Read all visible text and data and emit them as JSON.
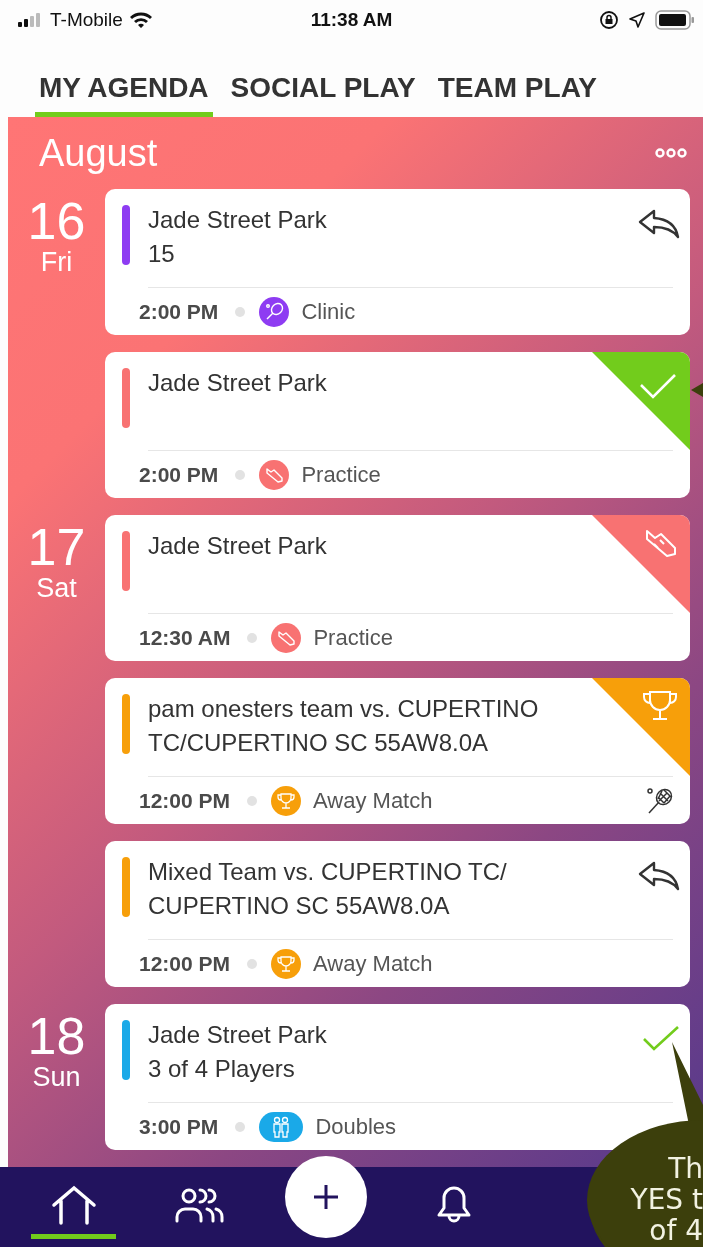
{
  "status_bar": {
    "carrier": "T-Mobile",
    "time": "11:38 AM"
  },
  "tabs": [
    {
      "label": "MY AGENDA",
      "selected": true
    },
    {
      "label": "SOCIAL PLAY",
      "selected": false
    },
    {
      "label": "TEAM PLAY",
      "selected": false
    }
  ],
  "month": "August",
  "days": [
    {
      "day": "16",
      "weekday": "Fri",
      "events": [
        {
          "color": "#8e3cf2",
          "lines": [
            "Jade Street Park",
            "15"
          ],
          "time": "2:00 PM",
          "category": {
            "kind": "clinic",
            "label": "Clinic"
          },
          "corner": {
            "kind": "reply"
          },
          "racquet": false
        },
        {
          "color": "#f87272",
          "lines": [
            "Jade Street Park"
          ],
          "time": "2:00 PM",
          "category": {
            "kind": "practice",
            "label": "Practice"
          },
          "corner": {
            "kind": "checkbanner"
          },
          "racquet": false
        }
      ]
    },
    {
      "day": "17",
      "weekday": "Sat",
      "events": [
        {
          "color": "#f87272",
          "lines": [
            "Jade Street Park"
          ],
          "time": "12:30 AM",
          "category": {
            "kind": "practice",
            "label": "Practice"
          },
          "corner": {
            "kind": "shoebanner"
          },
          "racquet": false
        },
        {
          "color": "#f79f0a",
          "lines": [
            "pam onesters team vs. CUPERTINO",
            "TC/CUPERTINO SC 55AW8.0A"
          ],
          "time": "12:00 PM",
          "category": {
            "kind": "match",
            "label": "Away Match"
          },
          "corner": {
            "kind": "trophybanner"
          },
          "racquet": true
        },
        {
          "color": "#f79f0a",
          "lines": [
            "Mixed Team vs. CUPERTINO TC/",
            "CUPERTINO SC 55AW8.0A"
          ],
          "time": "12:00 PM",
          "category": {
            "kind": "match",
            "label": "Away Match"
          },
          "corner": {
            "kind": "reply"
          },
          "racquet": false
        }
      ]
    },
    {
      "day": "18",
      "weekday": "Sun",
      "events": [
        {
          "color": "#1aa9e8",
          "lines": [
            "Jade Street Park",
            "3 of 4 Players"
          ],
          "time": "3:00 PM",
          "category": {
            "kind": "doubles",
            "label": "Doubles"
          },
          "corner": {
            "kind": "check"
          },
          "racquet": false
        }
      ]
    }
  ],
  "nav": [
    {
      "kind": "home",
      "selected": true
    },
    {
      "kind": "people",
      "selected": false
    },
    {
      "kind": "add",
      "selected": false
    },
    {
      "kind": "bell",
      "selected": false
    }
  ],
  "callout": {
    "lines": [
      "Th",
      "YES t",
      "of 4"
    ]
  }
}
